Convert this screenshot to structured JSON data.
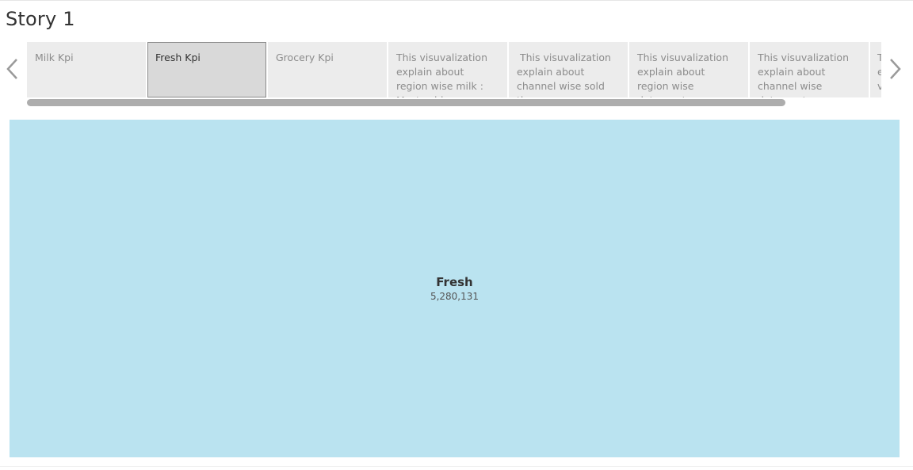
{
  "story": {
    "title": "Story 1"
  },
  "nav": {
    "prev_icon": "chevron-left-icon",
    "next_icon": "chevron-right-icon"
  },
  "story_points": [
    {
      "text": "Milk Kpi",
      "active": false
    },
    {
      "text": "Fresh Kpi",
      "active": true
    },
    {
      "text": "Grocery Kpi",
      "active": false
    },
    {
      "text": "This visuvalization explain about  region wise milk : Most sold",
      "active": false
    },
    {
      "text": " This visuvalization explain about  channel wise sold the",
      "active": false
    },
    {
      "text": "This visuvalization explain about  region wise  detergent paper",
      "active": false
    },
    {
      "text": "This visuvalization explain about  channel wise detergent paper",
      "active": false
    },
    {
      "text": "T e v",
      "active": false
    }
  ],
  "viz": {
    "label": "Fresh",
    "value": "5,280,131",
    "fill_color": "#bae3f0"
  },
  "chart_data": {
    "type": "treemap",
    "categories": [
      "Fresh"
    ],
    "values": [
      5280131
    ]
  }
}
